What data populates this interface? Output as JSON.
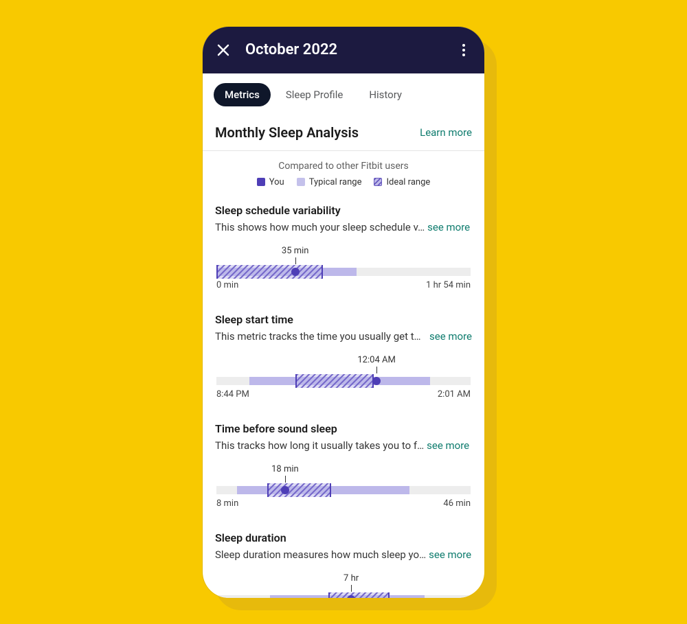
{
  "header": {
    "title": "October 2022"
  },
  "tabs": [
    {
      "label": "Metrics",
      "active": true
    },
    {
      "label": "Sleep Profile",
      "active": false
    },
    {
      "label": "History",
      "active": false
    }
  ],
  "section": {
    "title": "Monthly Sleep Analysis",
    "learn_more": "Learn more",
    "compare_label": "Compared to other Fitbit users"
  },
  "legend": {
    "you": "You",
    "typical": "Typical range",
    "ideal": "Ideal range"
  },
  "see_more": "see more",
  "metrics": [
    {
      "title": "Sleep schedule variability",
      "desc": "This shows how much your sleep schedule v…",
      "value_label": "35 min",
      "min_label": "0 min",
      "max_label": "1 hr 54 min"
    },
    {
      "title": "Sleep start time",
      "desc": "This metric tracks the time you usually get to…",
      "value_label": "12:04 AM",
      "min_label": "8:44 PM",
      "max_label": "2:01 AM"
    },
    {
      "title": "Time before sound sleep",
      "desc": "This tracks how long it usually takes you to f…",
      "value_label": "18 min",
      "min_label": "8 min",
      "max_label": "46 min"
    },
    {
      "title": "Sleep duration",
      "desc": "Sleep duration measures how much sleep yo…",
      "value_label": "7 hr",
      "min_label": "",
      "max_label": ""
    }
  ],
  "chart_data": [
    {
      "type": "range-marker",
      "title": "Sleep schedule variability",
      "unit": "min",
      "axis": [
        0,
        114
      ],
      "min_label": "0 min",
      "max_label": "1 hr 54 min",
      "typical_range": [
        0,
        63
      ],
      "ideal_range": [
        0,
        48
      ],
      "you": 35,
      "you_label": "35 min"
    },
    {
      "type": "range-marker",
      "title": "Sleep start time",
      "unit": "time",
      "axis": [
        "8:44 PM",
        "2:01 AM"
      ],
      "typical_range_pct": [
        13,
        84
      ],
      "ideal_range_pct": [
        31,
        62
      ],
      "you_pct": 63,
      "you_label": "12:04 AM"
    },
    {
      "type": "range-marker",
      "title": "Time before sound sleep",
      "unit": "min",
      "axis": [
        8,
        46
      ],
      "min_label": "8 min",
      "max_label": "46 min",
      "typical_range": [
        11,
        37
      ],
      "ideal_range": [
        16,
        26
      ],
      "you": 18,
      "you_label": "18 min"
    },
    {
      "type": "range-marker",
      "title": "Sleep duration",
      "unit": "hr",
      "you_label": "7 hr",
      "typical_range_pct": [
        21,
        82
      ],
      "ideal_range_pct": [
        44,
        68
      ],
      "you_pct": 53
    }
  ]
}
